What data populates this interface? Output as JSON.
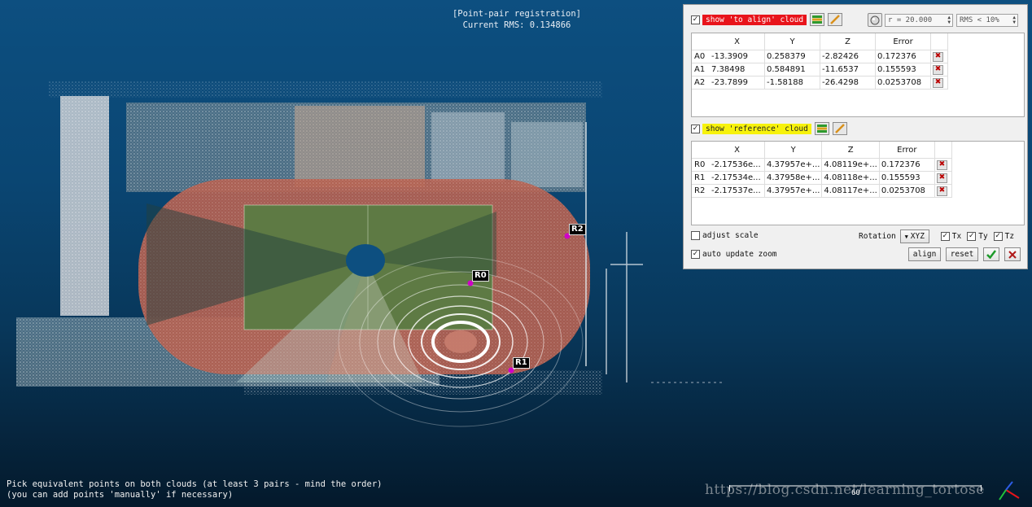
{
  "viewport": {
    "title": "[Point-pair registration]",
    "rms_label": "Current RMS: 0.134866",
    "hint_line1": "Pick equivalent points on both clouds (at least 3 pairs - mind the order)",
    "hint_line2": "(you can add points 'manually' if necessary)",
    "scale_value": "60",
    "watermark": "https://blog.csdn.net/learning_tortose",
    "markers": [
      {
        "label": "R0"
      },
      {
        "label": "R1"
      },
      {
        "label": "R2"
      }
    ],
    "marker_color": "#d000c8"
  },
  "panel": {
    "align_cloud": {
      "checked": "✓",
      "label": "show 'to align' cloud",
      "color": "#e8141b",
      "radius": "r = 20.000",
      "rms": "RMS < 10%",
      "headers": [
        "X",
        "Y",
        "Z",
        "Error"
      ],
      "rows": [
        {
          "id": "A0",
          "x": "-13.3909",
          "y": "0.258379",
          "z": "-2.82426",
          "error": "0.172376"
        },
        {
          "id": "A1",
          "x": "7.38498",
          "y": "0.584891",
          "z": "-11.6537",
          "error": "0.155593"
        },
        {
          "id": "A2",
          "x": "-23.7899",
          "y": "-1.58188",
          "z": "-26.4298",
          "error": "0.0253708"
        }
      ]
    },
    "reference_cloud": {
      "checked": "✓",
      "label": "show 'reference' cloud",
      "color": "#f7f20c",
      "headers": [
        "X",
        "Y",
        "Z",
        "Error"
      ],
      "rows": [
        {
          "id": "R0",
          "x": "-2.17536e...",
          "y": "4.37957e+...",
          "z": "4.08119e+...",
          "error": "0.172376"
        },
        {
          "id": "R1",
          "x": "-2.17534e...",
          "y": "4.37958e+...",
          "z": "4.08118e+...",
          "error": "0.155593"
        },
        {
          "id": "R2",
          "x": "-2.17537e...",
          "y": "4.37957e+...",
          "z": "4.08117e+...",
          "error": "0.0253708"
        }
      ]
    },
    "options": {
      "adjust_scale_label": "adjust scale",
      "auto_update_zoom_label": "auto update zoom",
      "auto_update_zoom_checked": "✓",
      "rotation_label": "Rotation",
      "rotation_value": "XYZ",
      "tx_label": "Tx",
      "ty_label": "Ty",
      "tz_label": "Tz",
      "check_mark": "✓",
      "align_label": "align",
      "reset_label": "reset"
    },
    "delete_glyph": "✖"
  }
}
